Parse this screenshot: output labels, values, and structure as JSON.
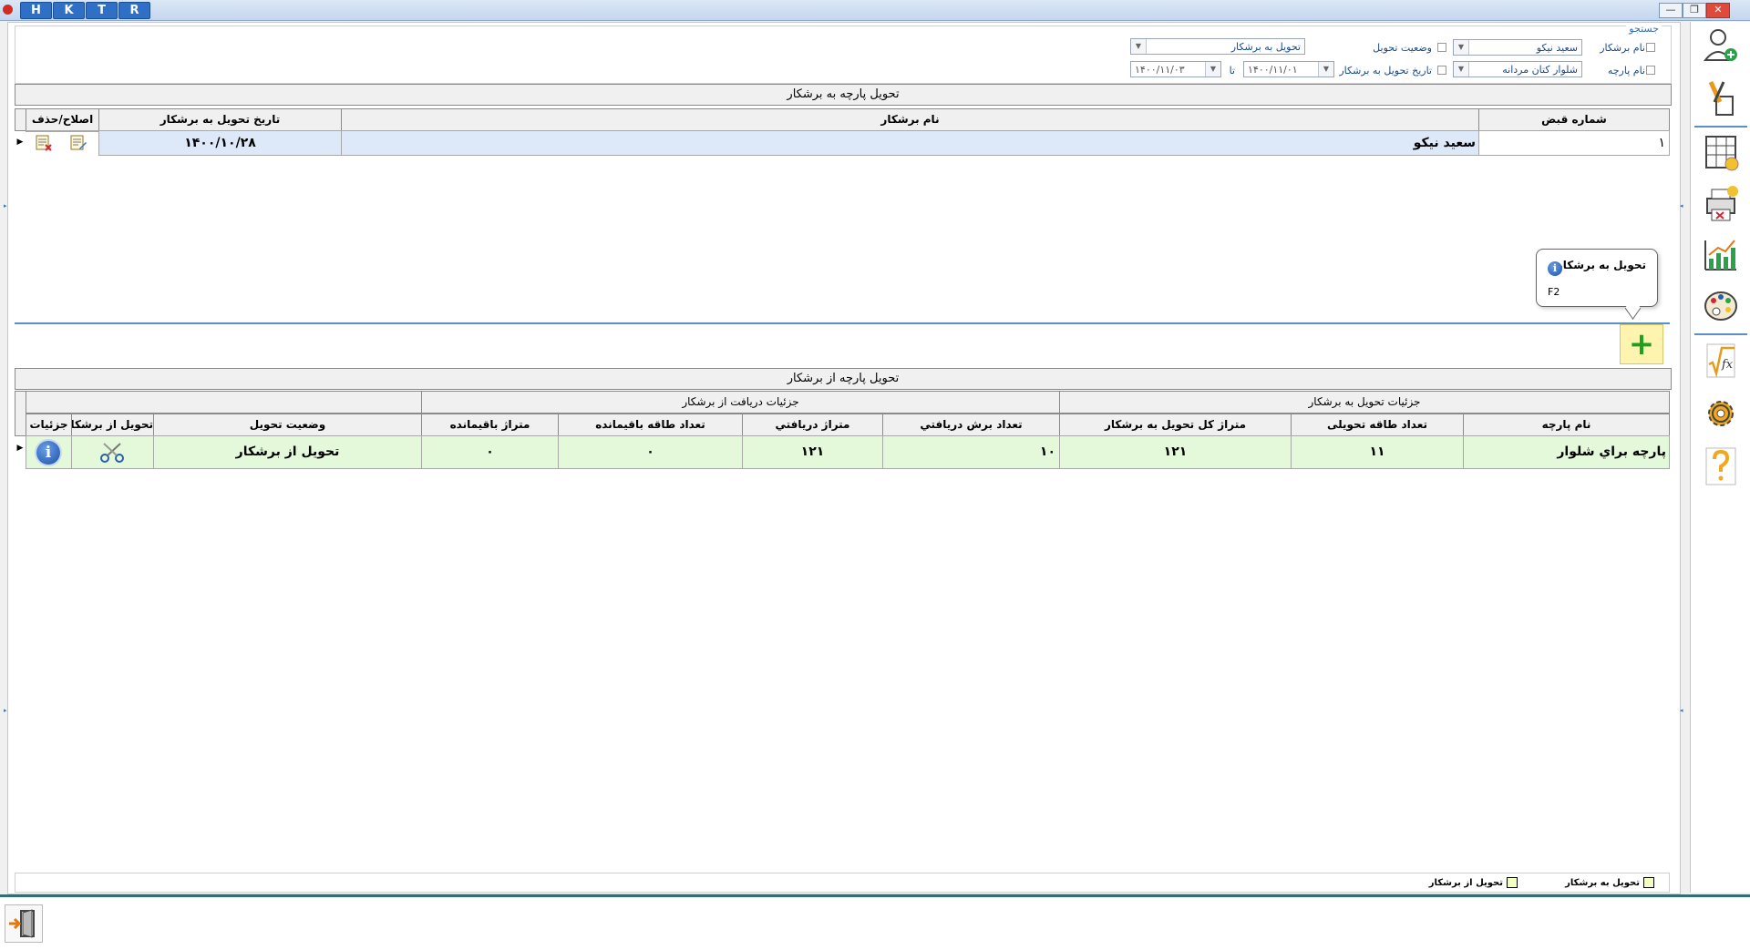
{
  "titlebar": {
    "buttons": [
      "H",
      "K",
      "T",
      "R"
    ],
    "controls": {
      "minimize": "—",
      "restore": "❐",
      "close": "✕"
    }
  },
  "search": {
    "title": "جستجو",
    "fabric_name_label": "نام پارچه",
    "fabric_name_value": "شلوار کتان مردانه",
    "cutter_name_label": "نام برشکار",
    "cutter_name_value": "سعید نیکو",
    "delivery_status_label": "وضعيت تحویل",
    "delivery_status_value": "تحویل به برشکار",
    "delivery_date_label": "تاریخ تحویل به برشکار",
    "date_from": "۱۴۰۰/۱۱/۰۱",
    "date_to_label": "تا",
    "date_to": "۱۴۰۰/۱۱/۰۳"
  },
  "grid1": {
    "title": "تحویل پارچه به برشکار",
    "headers": {
      "receipt_no": "شماره قبض",
      "cutter_name": "نام برشکار",
      "delivery_date": "تاریخ تحویل به برشکار",
      "edit_delete": "اصلاح/حذف"
    },
    "rows": [
      {
        "receipt_no": "۱",
        "cutter_name": "سعید نیکو",
        "delivery_date": "۱۴۰۰/۱۰/۲۸"
      }
    ]
  },
  "tooltip": {
    "title": "تحویل به برشکار",
    "shortcut": "F2",
    "info_glyph": "i"
  },
  "add_button": {
    "glyph": "+"
  },
  "grid2": {
    "title": "تحویل پارچه از برشکار",
    "group_delivery": "جزئیات تحویل به برشکار",
    "group_receive": "جزئیات دریافت از برشکار",
    "headers": {
      "fabric_name": "نام پارچه",
      "piece_count": "تعداد طاقه تحویلی",
      "total_meter": "متراژ کل تحویل به برشکار",
      "cut_count": "تعداد برش دریافتي",
      "received_meter": "متراژ دریافتي",
      "remaining_pieces": "تعداد طاقه باقیمانده",
      "remaining_meter": "متراژ باقیمانده",
      "status": "وضعیت تحویل",
      "receive": "تحویل از برشکار",
      "details": "جزئیات"
    },
    "rows": [
      {
        "fabric_name": "پارچه براي شلوار",
        "piece_count": "۱۱",
        "total_meter": "۱۲۱",
        "cut_count": "۱۰",
        "received_meter": "۱۲۱",
        "remaining_pieces": "۰",
        "remaining_meter": "۰",
        "status": "تحویل از برشکار",
        "info_glyph": "i"
      }
    ]
  },
  "legend": {
    "item1": "تحویل به برشکار",
    "item2": "تحویل از برشکار"
  },
  "colors": {
    "selected_row": "#dde8f8",
    "received_row": "#e4f9d9",
    "accent": "#5a8fc8",
    "add_button": "#fff3b0"
  },
  "sidebar": {
    "icons": [
      "add-user-icon",
      "tools-icon",
      "price-table-icon",
      "print-cancel-icon",
      "chart-icon",
      "palette-icon",
      "formula-icon",
      "gear-icon",
      "help-icon"
    ]
  }
}
